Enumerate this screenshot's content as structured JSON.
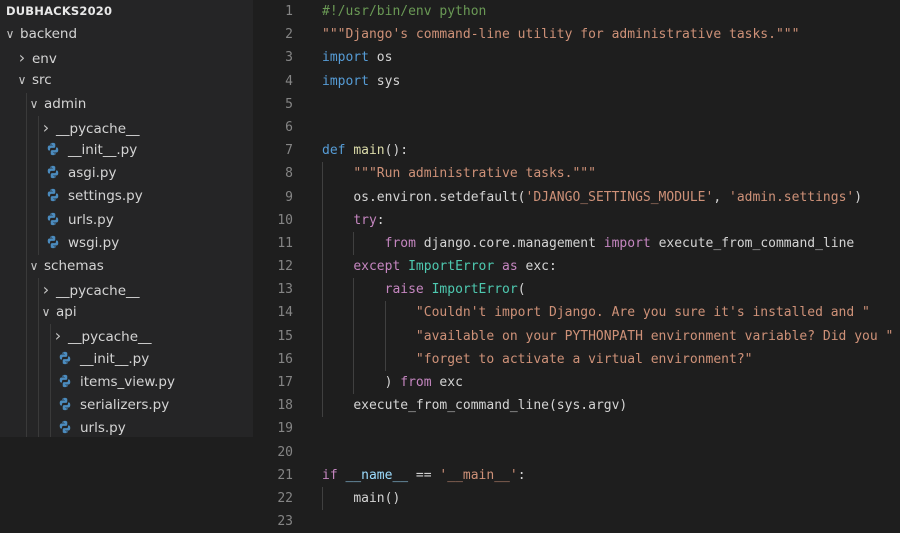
{
  "explorer": {
    "title": "DUBHACKS2020",
    "items": [
      {
        "label": "backend",
        "type": "folder",
        "open": true,
        "depth": 0
      },
      {
        "label": "env",
        "type": "folder",
        "open": false,
        "depth": 1
      },
      {
        "label": "src",
        "type": "folder",
        "open": true,
        "depth": 1
      },
      {
        "label": "admin",
        "type": "folder",
        "open": true,
        "depth": 2
      },
      {
        "label": "__pycache__",
        "type": "folder",
        "open": false,
        "depth": 3
      },
      {
        "label": "__init__.py",
        "type": "file",
        "depth": 3
      },
      {
        "label": "asgi.py",
        "type": "file",
        "depth": 3
      },
      {
        "label": "settings.py",
        "type": "file",
        "depth": 3
      },
      {
        "label": "urls.py",
        "type": "file",
        "depth": 3
      },
      {
        "label": "wsgi.py",
        "type": "file",
        "depth": 3
      },
      {
        "label": "schemas",
        "type": "folder",
        "open": true,
        "depth": 2
      },
      {
        "label": "__pycache__",
        "type": "folder",
        "open": false,
        "depth": 3
      },
      {
        "label": "api",
        "type": "folder",
        "open": true,
        "depth": 3
      },
      {
        "label": "__pycache__",
        "type": "folder",
        "open": false,
        "depth": 4
      },
      {
        "label": "__init__.py",
        "type": "file",
        "depth": 4
      },
      {
        "label": "items_view.py",
        "type": "file",
        "depth": 4
      },
      {
        "label": "serializers.py",
        "type": "file",
        "depth": 4
      },
      {
        "label": "urls.py",
        "type": "file",
        "depth": 4
      }
    ]
  },
  "icons": {
    "chevron_open": "chevron-down-icon",
    "chevron_closed": "chevron-right-icon",
    "python": "python-file-icon"
  },
  "colors": {
    "editor_bg": "#1e1e1e",
    "sidebar_bg": "#252526",
    "keyword": "#569cd6",
    "control": "#c586c0",
    "string": "#ce9178",
    "function": "#dcdcaa",
    "class": "#4ec9b0",
    "comment": "#6a9955",
    "python_icon": "#4b8bbe"
  },
  "editor": {
    "lines": [
      {
        "n": "1",
        "indent": 0,
        "tokens": [
          [
            "c",
            "#!/usr/bin/env python"
          ]
        ]
      },
      {
        "n": "2",
        "indent": 0,
        "tokens": [
          [
            "s",
            "\"\"\"Django's command-line utility for administrative tasks.\"\"\""
          ]
        ]
      },
      {
        "n": "3",
        "indent": 0,
        "tokens": [
          [
            "k",
            "import"
          ],
          [
            "p",
            " os"
          ]
        ]
      },
      {
        "n": "4",
        "indent": 0,
        "tokens": [
          [
            "k",
            "import"
          ],
          [
            "p",
            " sys"
          ]
        ]
      },
      {
        "n": "5",
        "indent": 0,
        "tokens": []
      },
      {
        "n": "6",
        "indent": 0,
        "tokens": []
      },
      {
        "n": "7",
        "indent": 0,
        "tokens": [
          [
            "k",
            "def"
          ],
          [
            "p",
            " "
          ],
          [
            "f",
            "main"
          ],
          [
            "p",
            "():"
          ]
        ]
      },
      {
        "n": "8",
        "indent": 1,
        "tokens": [
          [
            "s",
            "\"\"\"Run administrative tasks.\"\"\""
          ]
        ]
      },
      {
        "n": "9",
        "indent": 1,
        "tokens": [
          [
            "p",
            "os.environ.setdefault("
          ],
          [
            "s",
            "'DJANGO_SETTINGS_MODULE'"
          ],
          [
            "p",
            ", "
          ],
          [
            "s",
            "'admin.settings'"
          ],
          [
            "p",
            ")"
          ]
        ]
      },
      {
        "n": "10",
        "indent": 1,
        "tokens": [
          [
            "x",
            "try"
          ],
          [
            "p",
            ":"
          ]
        ]
      },
      {
        "n": "11",
        "indent": 2,
        "tokens": [
          [
            "x",
            "from"
          ],
          [
            "p",
            " django.core.management "
          ],
          [
            "x",
            "import"
          ],
          [
            "p",
            " execute_from_command_line"
          ]
        ]
      },
      {
        "n": "12",
        "indent": 1,
        "tokens": [
          [
            "x",
            "except"
          ],
          [
            "p",
            " "
          ],
          [
            "t",
            "ImportError"
          ],
          [
            "p",
            " "
          ],
          [
            "x",
            "as"
          ],
          [
            "p",
            " exc:"
          ]
        ]
      },
      {
        "n": "13",
        "indent": 2,
        "tokens": [
          [
            "x",
            "raise"
          ],
          [
            "p",
            " "
          ],
          [
            "t",
            "ImportError"
          ],
          [
            "p",
            "("
          ]
        ]
      },
      {
        "n": "14",
        "indent": 3,
        "tokens": [
          [
            "s",
            "\"Couldn't import Django. Are you sure it's installed and \""
          ]
        ]
      },
      {
        "n": "15",
        "indent": 3,
        "tokens": [
          [
            "s",
            "\"available on your PYTHONPATH environment variable? Did you \""
          ]
        ]
      },
      {
        "n": "16",
        "indent": 3,
        "tokens": [
          [
            "s",
            "\"forget to activate a virtual environment?\""
          ]
        ]
      },
      {
        "n": "17",
        "indent": 2,
        "tokens": [
          [
            "p",
            ") "
          ],
          [
            "x",
            "from"
          ],
          [
            "p",
            " exc"
          ]
        ]
      },
      {
        "n": "18",
        "indent": 1,
        "tokens": [
          [
            "p",
            "execute_from_command_line(sys.argv)"
          ]
        ]
      },
      {
        "n": "19",
        "indent": 0,
        "tokens": []
      },
      {
        "n": "20",
        "indent": 0,
        "tokens": []
      },
      {
        "n": "21",
        "indent": 0,
        "tokens": [
          [
            "x",
            "if"
          ],
          [
            "p",
            " "
          ],
          [
            "v",
            "__name__"
          ],
          [
            "p",
            " == "
          ],
          [
            "s",
            "'__main__'"
          ],
          [
            "p",
            ":"
          ]
        ]
      },
      {
        "n": "22",
        "indent": 1,
        "tokens": [
          [
            "p",
            "main()"
          ]
        ]
      },
      {
        "n": "23",
        "indent": 0,
        "tokens": []
      }
    ]
  }
}
